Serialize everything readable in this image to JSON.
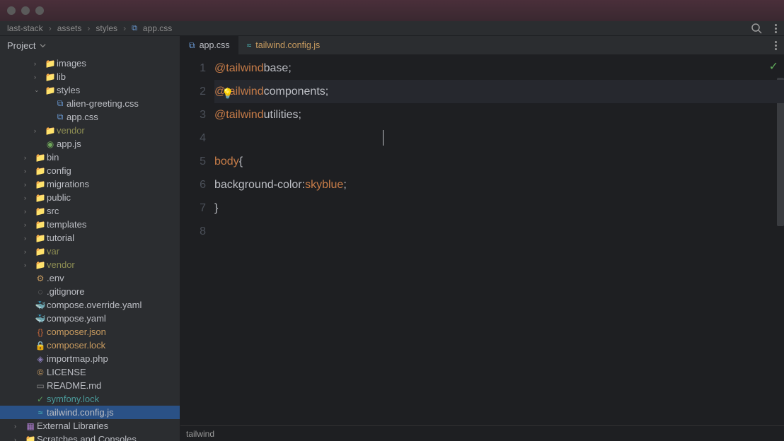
{
  "breadcrumbs": [
    "last-stack",
    "assets",
    "styles",
    "app.css"
  ],
  "sidebar": {
    "title": "Project",
    "items": [
      {
        "indent": 3,
        "arrow": "right",
        "icon": "folder-blue",
        "label": "images"
      },
      {
        "indent": 3,
        "arrow": "right",
        "icon": "folder-green",
        "label": "lib"
      },
      {
        "indent": 3,
        "arrow": "down",
        "icon": "folder-blue",
        "label": "styles"
      },
      {
        "indent": 4,
        "arrow": "",
        "icon": "css",
        "label": "alien-greeting.css"
      },
      {
        "indent": 4,
        "arrow": "",
        "icon": "css",
        "label": "app.css"
      },
      {
        "indent": 3,
        "arrow": "right",
        "icon": "folder-green",
        "label": "vendor",
        "style": "muted"
      },
      {
        "indent": 3,
        "arrow": "",
        "icon": "js",
        "label": "app.js"
      },
      {
        "indent": 2,
        "arrow": "right",
        "icon": "folder-blue",
        "label": "bin"
      },
      {
        "indent": 2,
        "arrow": "right",
        "icon": "folder-blue",
        "label": "config"
      },
      {
        "indent": 2,
        "arrow": "right",
        "icon": "folder-green",
        "label": "migrations"
      },
      {
        "indent": 2,
        "arrow": "right",
        "icon": "folder-blue",
        "label": "public"
      },
      {
        "indent": 2,
        "arrow": "right",
        "icon": "folder-blue",
        "label": "src"
      },
      {
        "indent": 2,
        "arrow": "right",
        "icon": "folder-yellow",
        "label": "templates"
      },
      {
        "indent": 2,
        "arrow": "right",
        "icon": "folder-orange",
        "label": "tutorial"
      },
      {
        "indent": 2,
        "arrow": "right",
        "icon": "folder-gray",
        "label": "var",
        "style": "muted"
      },
      {
        "indent": 2,
        "arrow": "right",
        "icon": "folder-green",
        "label": "vendor",
        "style": "muted"
      },
      {
        "indent": 2,
        "arrow": "",
        "icon": "env",
        "label": ".env"
      },
      {
        "indent": 2,
        "arrow": "",
        "icon": "git",
        "label": ".gitignore"
      },
      {
        "indent": 2,
        "arrow": "",
        "icon": "docker",
        "label": "compose.override.yaml"
      },
      {
        "indent": 2,
        "arrow": "",
        "icon": "docker",
        "label": "compose.yaml"
      },
      {
        "indent": 2,
        "arrow": "",
        "icon": "json",
        "label": "composer.json",
        "style": "orange"
      },
      {
        "indent": 2,
        "arrow": "",
        "icon": "lock",
        "label": "composer.lock",
        "style": "orange"
      },
      {
        "indent": 2,
        "arrow": "",
        "icon": "php",
        "label": "importmap.php"
      },
      {
        "indent": 2,
        "arrow": "",
        "icon": "license",
        "label": "LICENSE"
      },
      {
        "indent": 2,
        "arrow": "",
        "icon": "md",
        "label": "README.md"
      },
      {
        "indent": 2,
        "arrow": "",
        "icon": "check",
        "label": "symfony.lock",
        "style": "teal"
      },
      {
        "indent": 2,
        "arrow": "",
        "icon": "tw",
        "label": "tailwind.config.js",
        "selected": true
      }
    ],
    "bottom": [
      {
        "icon": "lib",
        "label": "External Libraries"
      },
      {
        "icon": "folder-gray",
        "label": "Scratches and Consoles"
      }
    ]
  },
  "tabs": [
    {
      "icon": "css",
      "label": "app.css",
      "active": true
    },
    {
      "icon": "tw",
      "label": "tailwind.config.js",
      "active": false
    }
  ],
  "code": {
    "lines": [
      [
        {
          "t": "dir",
          "v": "@tailwind"
        },
        {
          "t": "text",
          "v": " base"
        },
        {
          "t": "text",
          "v": ";"
        }
      ],
      [
        {
          "t": "dir",
          "v": "@tailwind"
        },
        {
          "t": "text",
          "v": " components"
        },
        {
          "t": "text",
          "v": ";"
        }
      ],
      [
        {
          "t": "dir",
          "v": "@tailwind"
        },
        {
          "t": "text",
          "v": " utilities"
        },
        {
          "t": "text",
          "v": ";"
        }
      ],
      [],
      [
        {
          "t": "kw",
          "v": "body "
        },
        {
          "t": "brace",
          "v": "{"
        }
      ],
      [
        {
          "t": "text",
          "v": "    background-color"
        },
        {
          "t": "text",
          "v": ": "
        },
        {
          "t": "kw",
          "v": "skyblue"
        },
        {
          "t": "text",
          "v": ";"
        }
      ],
      [
        {
          "t": "brace",
          "v": "}"
        }
      ],
      []
    ],
    "highlighted_line": 2
  },
  "status": "tailwind"
}
